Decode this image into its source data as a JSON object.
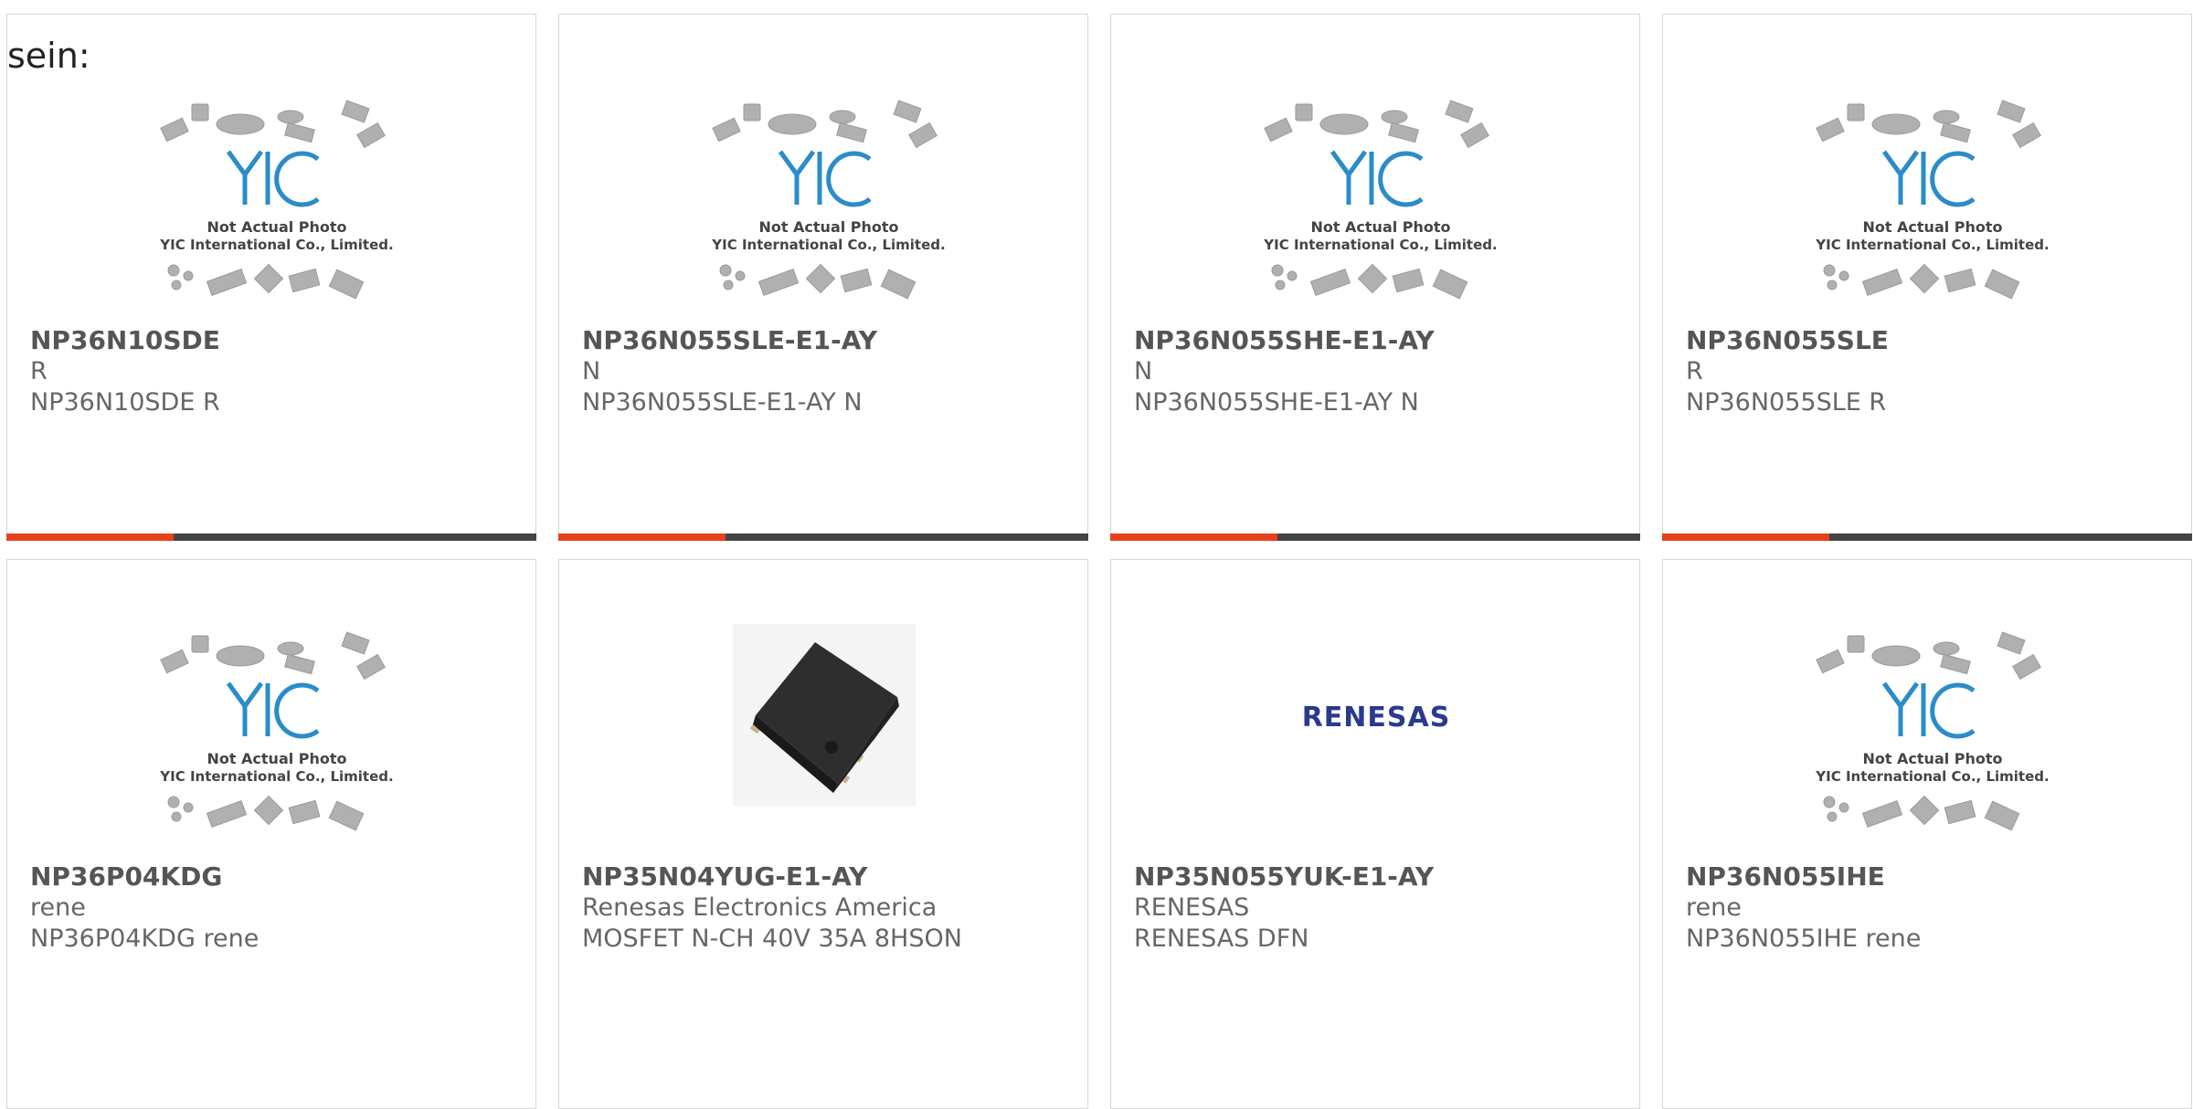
{
  "intro_text": "sein:",
  "colors": {
    "accent": "#e8401c",
    "bar": "#444444",
    "text": "#666666",
    "partnumber": "#555555",
    "yic_blue": "#2a8cc8",
    "renesas_blue": "#2a3a8c"
  },
  "placeholder": {
    "logo_text": "YIC",
    "line1": "Not Actual Photo",
    "line2": "YIC International Co., Limited."
  },
  "renesas_logo_text": "RENESAS",
  "products": [
    {
      "part": "NP36N10SDE",
      "maker": "R",
      "desc": "NP36N10SDE R",
      "image": "placeholder"
    },
    {
      "part": "NP36N055SLE-E1-AY",
      "maker": "N",
      "desc": "NP36N055SLE-E1-AY N",
      "image": "placeholder"
    },
    {
      "part": "NP36N055SHE-E1-AY",
      "maker": "N",
      "desc": "NP36N055SHE-E1-AY N",
      "image": "placeholder"
    },
    {
      "part": "NP36N055SLE",
      "maker": "R",
      "desc": "NP36N055SLE R",
      "image": "placeholder"
    },
    {
      "part": "NP36P04KDG",
      "maker": "rene",
      "desc": "NP36P04KDG rene",
      "image": "placeholder"
    },
    {
      "part": "NP35N04YUG-E1-AY",
      "maker": "Renesas Electronics America",
      "desc": "MOSFET N-CH 40V 35A 8HSON",
      "image": "chip-photo"
    },
    {
      "part": "NP35N055YUK-E1-AY",
      "maker": "RENESAS",
      "desc": "RENESAS DFN",
      "image": "renesas-logo"
    },
    {
      "part": "NP36N055IHE",
      "maker": "rene",
      "desc": "NP36N055IHE rene",
      "image": "placeholder"
    }
  ]
}
